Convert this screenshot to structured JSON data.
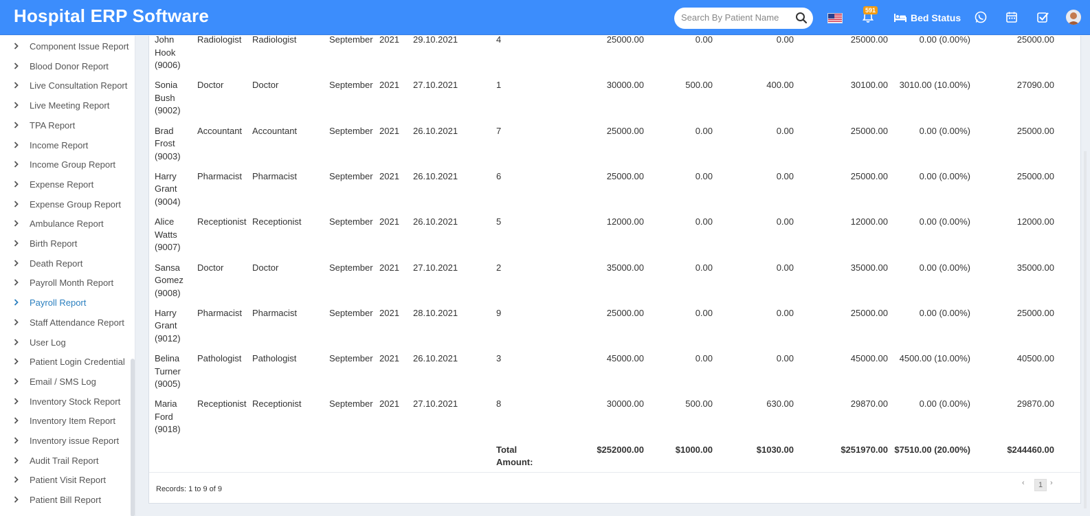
{
  "header": {
    "app_title": "Hospital ERP Software",
    "search_placeholder": "Search By Patient Name",
    "notification_count": "591",
    "bed_status_label": "Bed Status"
  },
  "sidebar": {
    "items": [
      {
        "label": "Component Issue Report"
      },
      {
        "label": "Blood Donor Report"
      },
      {
        "label": "Live Consultation Report"
      },
      {
        "label": "Live Meeting Report"
      },
      {
        "label": "TPA Report"
      },
      {
        "label": "Income Report"
      },
      {
        "label": "Income Group Report"
      },
      {
        "label": "Expense Report"
      },
      {
        "label": "Expense Group Report"
      },
      {
        "label": "Ambulance Report"
      },
      {
        "label": "Birth Report"
      },
      {
        "label": "Death Report"
      },
      {
        "label": "Payroll Month Report"
      },
      {
        "label": "Payroll Report",
        "active": true
      },
      {
        "label": "Staff Attendance Report"
      },
      {
        "label": "User Log"
      },
      {
        "label": "Patient Login Credential"
      },
      {
        "label": "Email / SMS Log"
      },
      {
        "label": "Inventory Stock Report"
      },
      {
        "label": "Inventory Item Report"
      },
      {
        "label": "Inventory issue Report"
      },
      {
        "label": "Audit Trail Report"
      },
      {
        "label": "Patient Visit Report"
      },
      {
        "label": "Patient Bill Report"
      }
    ]
  },
  "table": {
    "rows": [
      {
        "name1": "John",
        "name2": "Hook",
        "id": "(9006)",
        "role": "Radiologist",
        "designation": "Radiologist",
        "month": "September",
        "year": "2021",
        "date": "29.10.2021",
        "payslip": "4",
        "basic": "25000.00",
        "earning": "0.00",
        "deduction": "0.00",
        "gross": "25000.00",
        "tax": "0.00 (0.00%)",
        "net": "25000.00"
      },
      {
        "name1": "Sonia",
        "name2": "Bush",
        "id": "(9002)",
        "role": "Doctor",
        "designation": "Doctor",
        "month": "September",
        "year": "2021",
        "date": "27.10.2021",
        "payslip": "1",
        "basic": "30000.00",
        "earning": "500.00",
        "deduction": "400.00",
        "gross": "30100.00",
        "tax": "3010.00 (10.00%)",
        "net": "27090.00"
      },
      {
        "name1": "Brad",
        "name2": "Frost",
        "id": "(9003)",
        "role": "Accountant",
        "designation": "Accountant",
        "month": "September",
        "year": "2021",
        "date": "26.10.2021",
        "payslip": "7",
        "basic": "25000.00",
        "earning": "0.00",
        "deduction": "0.00",
        "gross": "25000.00",
        "tax": "0.00 (0.00%)",
        "net": "25000.00"
      },
      {
        "name1": "Harry",
        "name2": "Grant",
        "id": "(9004)",
        "role": "Pharmacist",
        "designation": "Pharmacist",
        "month": "September",
        "year": "2021",
        "date": "26.10.2021",
        "payslip": "6",
        "basic": "25000.00",
        "earning": "0.00",
        "deduction": "0.00",
        "gross": "25000.00",
        "tax": "0.00 (0.00%)",
        "net": "25000.00"
      },
      {
        "name1": "Alice",
        "name2": "Watts",
        "id": "(9007)",
        "role": "Receptionist",
        "designation": "Receptionist",
        "month": "September",
        "year": "2021",
        "date": "26.10.2021",
        "payslip": "5",
        "basic": "12000.00",
        "earning": "0.00",
        "deduction": "0.00",
        "gross": "12000.00",
        "tax": "0.00 (0.00%)",
        "net": "12000.00"
      },
      {
        "name1": "Sansa",
        "name2": "Gomez",
        "id": "(9008)",
        "role": "Doctor",
        "designation": "Doctor",
        "month": "September",
        "year": "2021",
        "date": "27.10.2021",
        "payslip": "2",
        "basic": "35000.00",
        "earning": "0.00",
        "deduction": "0.00",
        "gross": "35000.00",
        "tax": "0.00 (0.00%)",
        "net": "35000.00"
      },
      {
        "name1": "Harry",
        "name2": "Grant",
        "id": "(9012)",
        "role": "Pharmacist",
        "designation": "Pharmacist",
        "month": "September",
        "year": "2021",
        "date": "28.10.2021",
        "payslip": "9",
        "basic": "25000.00",
        "earning": "0.00",
        "deduction": "0.00",
        "gross": "25000.00",
        "tax": "0.00 (0.00%)",
        "net": "25000.00"
      },
      {
        "name1": "Belina",
        "name2": "Turner",
        "id": "(9005)",
        "role": "Pathologist",
        "designation": "Pathologist",
        "month": "September",
        "year": "2021",
        "date": "26.10.2021",
        "payslip": "3",
        "basic": "45000.00",
        "earning": "0.00",
        "deduction": "0.00",
        "gross": "45000.00",
        "tax": "4500.00 (10.00%)",
        "net": "40500.00"
      },
      {
        "name1": "Maria",
        "name2": "Ford",
        "id": "(9018)",
        "role": "Receptionist",
        "designation": "Receptionist",
        "month": "September",
        "year": "2021",
        "date": "27.10.2021",
        "payslip": "8",
        "basic": "30000.00",
        "earning": "500.00",
        "deduction": "630.00",
        "gross": "29870.00",
        "tax": "0.00 (0.00%)",
        "net": "29870.00"
      }
    ],
    "total": {
      "label1": "Total",
      "label2": "Amount:",
      "basic": "$252000.00",
      "earning": "$1000.00",
      "deduction": "$1030.00",
      "gross": "$251970.00",
      "tax": "$7510.00 (20.00%)",
      "net": "$244460.00"
    }
  },
  "footer": {
    "records_text": "Records: 1 to 9 of 9",
    "page": "1",
    "prev_glyph": "‹",
    "next_glyph": "›"
  },
  "colors": {
    "header_bg": "#3c8dfc",
    "active_link": "#2a7fbf",
    "badge": "#f39c12"
  }
}
